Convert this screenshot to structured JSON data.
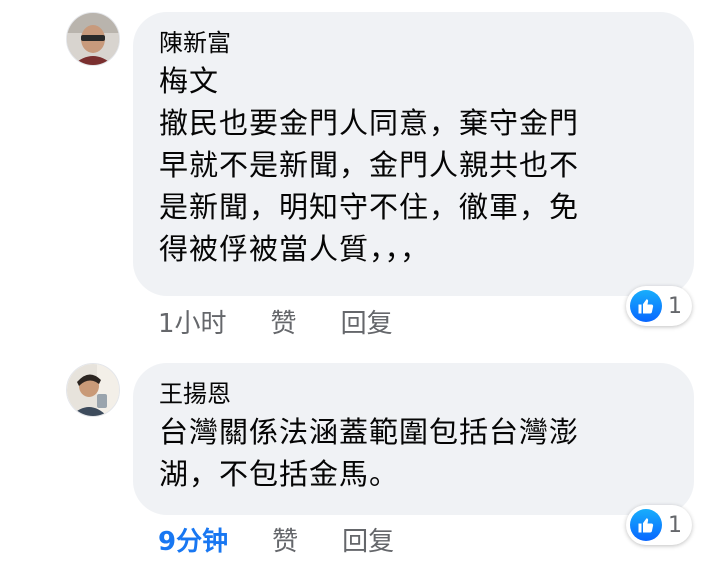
{
  "comments": [
    {
      "author": "陳新富",
      "lines": [
        "梅文",
        "撤民也要金門人同意，棄守金門",
        "早就不是新聞，金門人親共也不",
        "是新聞，明知守不住，徹軍，免",
        "得被俘被當人質，，，"
      ],
      "time": "1小时",
      "like_label": "赞",
      "reply_label": "回复",
      "reaction_icon": "thumbs-up-icon",
      "reaction_count": "1"
    },
    {
      "author": "王揚恩",
      "lines": [
        "台灣關係法涵蓋範圍包括台灣澎",
        "湖，不包括金馬。"
      ],
      "time": "9分钟",
      "like_label": "赞",
      "reply_label": "回复",
      "reaction_icon": "thumbs-up-icon",
      "reaction_count": "1"
    }
  ],
  "colors": {
    "bubble": "#f0f2f5",
    "accent": "#1877f2",
    "meta": "#65676b"
  }
}
